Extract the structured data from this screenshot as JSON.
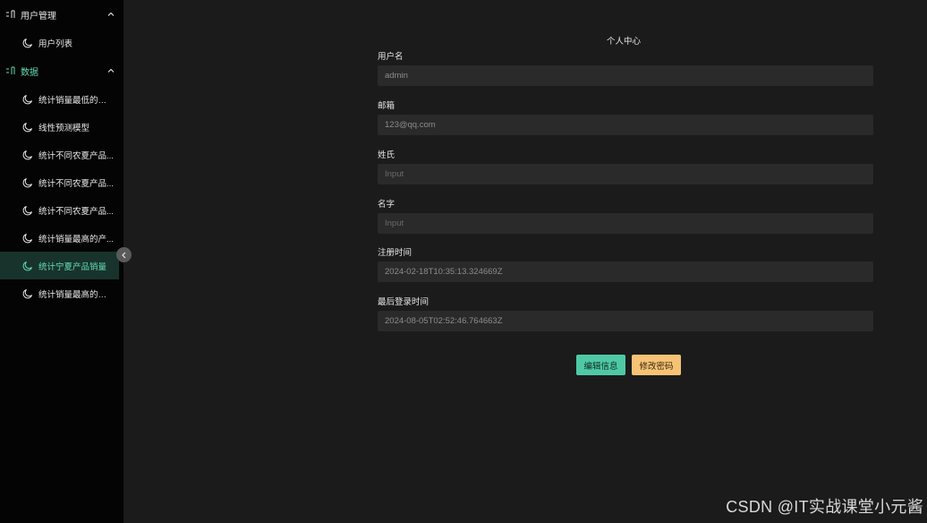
{
  "sidebar": {
    "groups": [
      {
        "label": "用户管理",
        "items": [
          {
            "label": "用户列表"
          }
        ]
      },
      {
        "label": "数据",
        "items": [
          {
            "label": "统计销量最低的产品"
          },
          {
            "label": "线性预测模型"
          },
          {
            "label": "统计不同农夏产品..."
          },
          {
            "label": "统计不同农夏产品..."
          },
          {
            "label": "统计不同农夏产品..."
          },
          {
            "label": "统计销量最高的产..."
          },
          {
            "label": "统计宁夏产品销量",
            "active": true
          },
          {
            "label": "统计销量最高的产品"
          }
        ]
      }
    ]
  },
  "main": {
    "title": "个人中心",
    "fields": [
      {
        "label": "用户名",
        "value": "admin",
        "placeholder": ""
      },
      {
        "label": "邮箱",
        "value": "123@qq.com",
        "placeholder": ""
      },
      {
        "label": "姓氏",
        "value": "",
        "placeholder": "Input"
      },
      {
        "label": "名字",
        "value": "",
        "placeholder": "Input"
      },
      {
        "label": "注册时间",
        "value": "2024-02-18T10:35:13.324669Z",
        "placeholder": ""
      },
      {
        "label": "最后登录时间",
        "value": "2024-08-05T02:52:46.764663Z",
        "placeholder": ""
      }
    ],
    "buttons": {
      "edit": "编辑信息",
      "password": "修改密码"
    }
  },
  "watermark": "CSDN @IT实战课堂小元酱",
  "colors": {
    "accent": "#4fc9a5",
    "warning": "#f6c275",
    "active_bg": "#18332c"
  }
}
